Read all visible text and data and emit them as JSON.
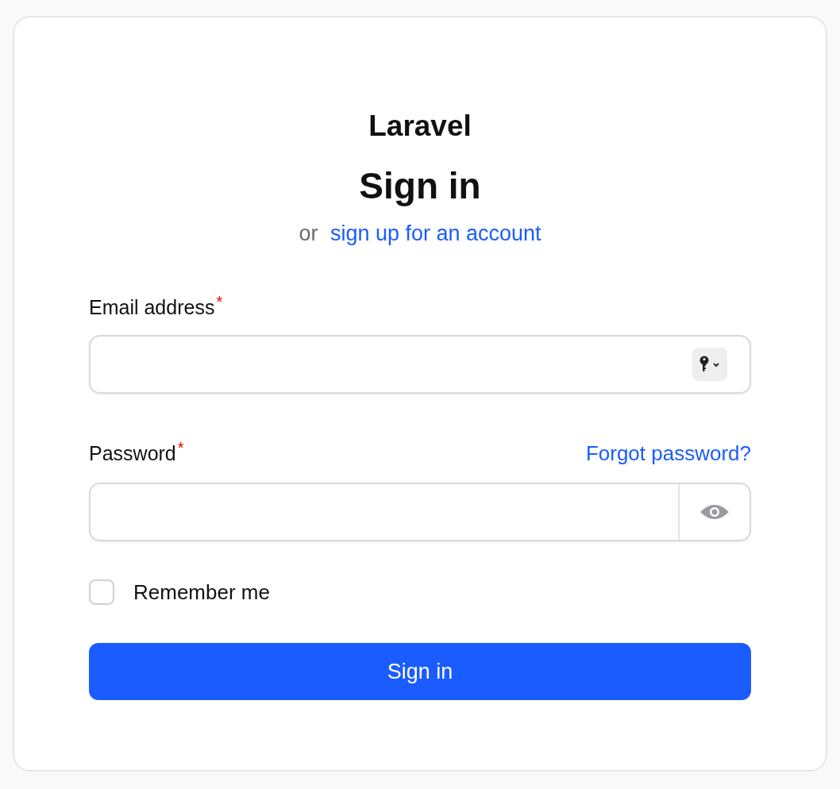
{
  "logo": "Laravel",
  "title": "Sign in",
  "subtitle": {
    "prefix": "or",
    "link": "sign up for an account"
  },
  "fields": [
    {
      "kind": "email",
      "label": "Email address",
      "required_mark": "*"
    },
    {
      "kind": "password",
      "label": "Password",
      "required_mark": "*",
      "link": "Forgot password?"
    }
  ],
  "remember": {
    "label": "Remember me",
    "checked": false
  },
  "submit": "Sign in"
}
